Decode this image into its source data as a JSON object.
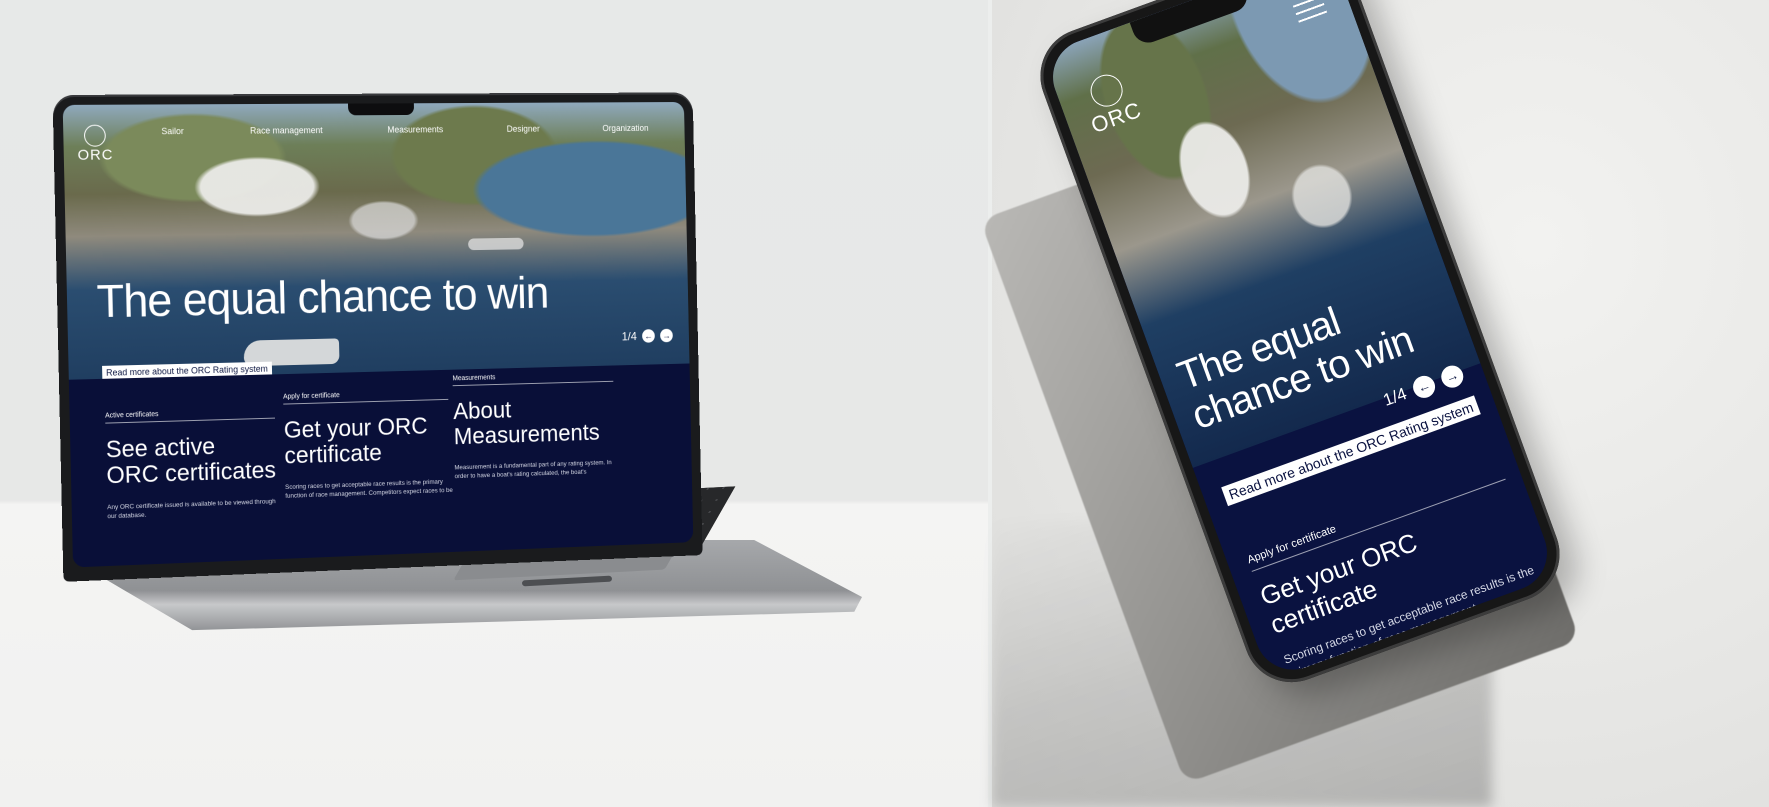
{
  "brand": {
    "logo_text": "ORC"
  },
  "nav": {
    "items": [
      "Sailor",
      "Race management",
      "Measurements",
      "Designer",
      "Organization"
    ]
  },
  "hero": {
    "title": "The equal chance to win",
    "title_line1": "The equal",
    "title_line2": "chance to win",
    "pager": "1/4",
    "read_more": "Read more about the ORC Rating system"
  },
  "cards": [
    {
      "label": "Active certificates",
      "heading_line1": "See active",
      "heading_line2": "ORC certificates",
      "body": "Any ORC certificate issued is available to be viewed through our database."
    },
    {
      "label": "Apply for certificate",
      "heading_line1": "Get your ORC",
      "heading_line2": "certificate",
      "body": "Scoring races to get acceptable race results is the primary function of race management. Competitors expect races to be"
    },
    {
      "label": "Measurements",
      "heading_line1": "About",
      "heading_line2": "Measurements",
      "body": "Measurement is a fundamental part of any rating system. In order to have a boat's rating calculated, the boat's"
    }
  ],
  "mobile": {
    "section_label": "Apply for certificate",
    "section_heading": "Get your ORC certificate",
    "section_body": "Scoring races to get acceptable race results is the primary function of race management. Competitors expect races to be run competently, and the results"
  },
  "icons": {
    "prev": "arrow-left-icon",
    "next": "arrow-right-icon",
    "menu": "hamburger-menu-icon",
    "logo": "orc-sail-logo-icon"
  },
  "colors": {
    "navy": "#090f38",
    "white": "#ffffff"
  }
}
